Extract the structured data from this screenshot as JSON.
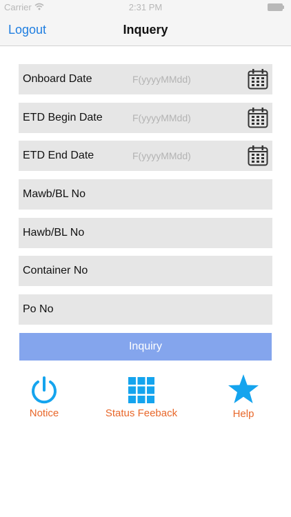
{
  "status_bar": {
    "carrier": "Carrier",
    "time": "2:31 PM"
  },
  "nav": {
    "back_label": "Logout",
    "title": "Inquery"
  },
  "form": {
    "fields": [
      {
        "label": "Onboard Date",
        "placeholder": "F(yyyyMMdd)",
        "has_calendar": true
      },
      {
        "label": "ETD Begin Date",
        "placeholder": "F(yyyyMMdd)",
        "has_calendar": true
      },
      {
        "label": "ETD End Date",
        "placeholder": "F(yyyyMMdd)",
        "has_calendar": true
      },
      {
        "label": "Mawb/BL No",
        "placeholder": "",
        "has_calendar": false
      },
      {
        "label": "Hawb/BL No",
        "placeholder": "",
        "has_calendar": false
      },
      {
        "label": "Container No",
        "placeholder": "",
        "has_calendar": false
      },
      {
        "label": "Po No",
        "placeholder": "",
        "has_calendar": false
      }
    ],
    "submit_label": "Inquiry"
  },
  "actions": [
    {
      "label": "Notice",
      "icon": "power-icon"
    },
    {
      "label": "Status Feeback",
      "icon": "grid-icon"
    },
    {
      "label": "Help",
      "icon": "star-icon"
    }
  ],
  "colors": {
    "accent": "#1f7ee0",
    "icon_blue": "#15a4ee",
    "action_label": "#e8672a",
    "button": "#84a5ed",
    "field_bg": "#e6e6e6"
  }
}
